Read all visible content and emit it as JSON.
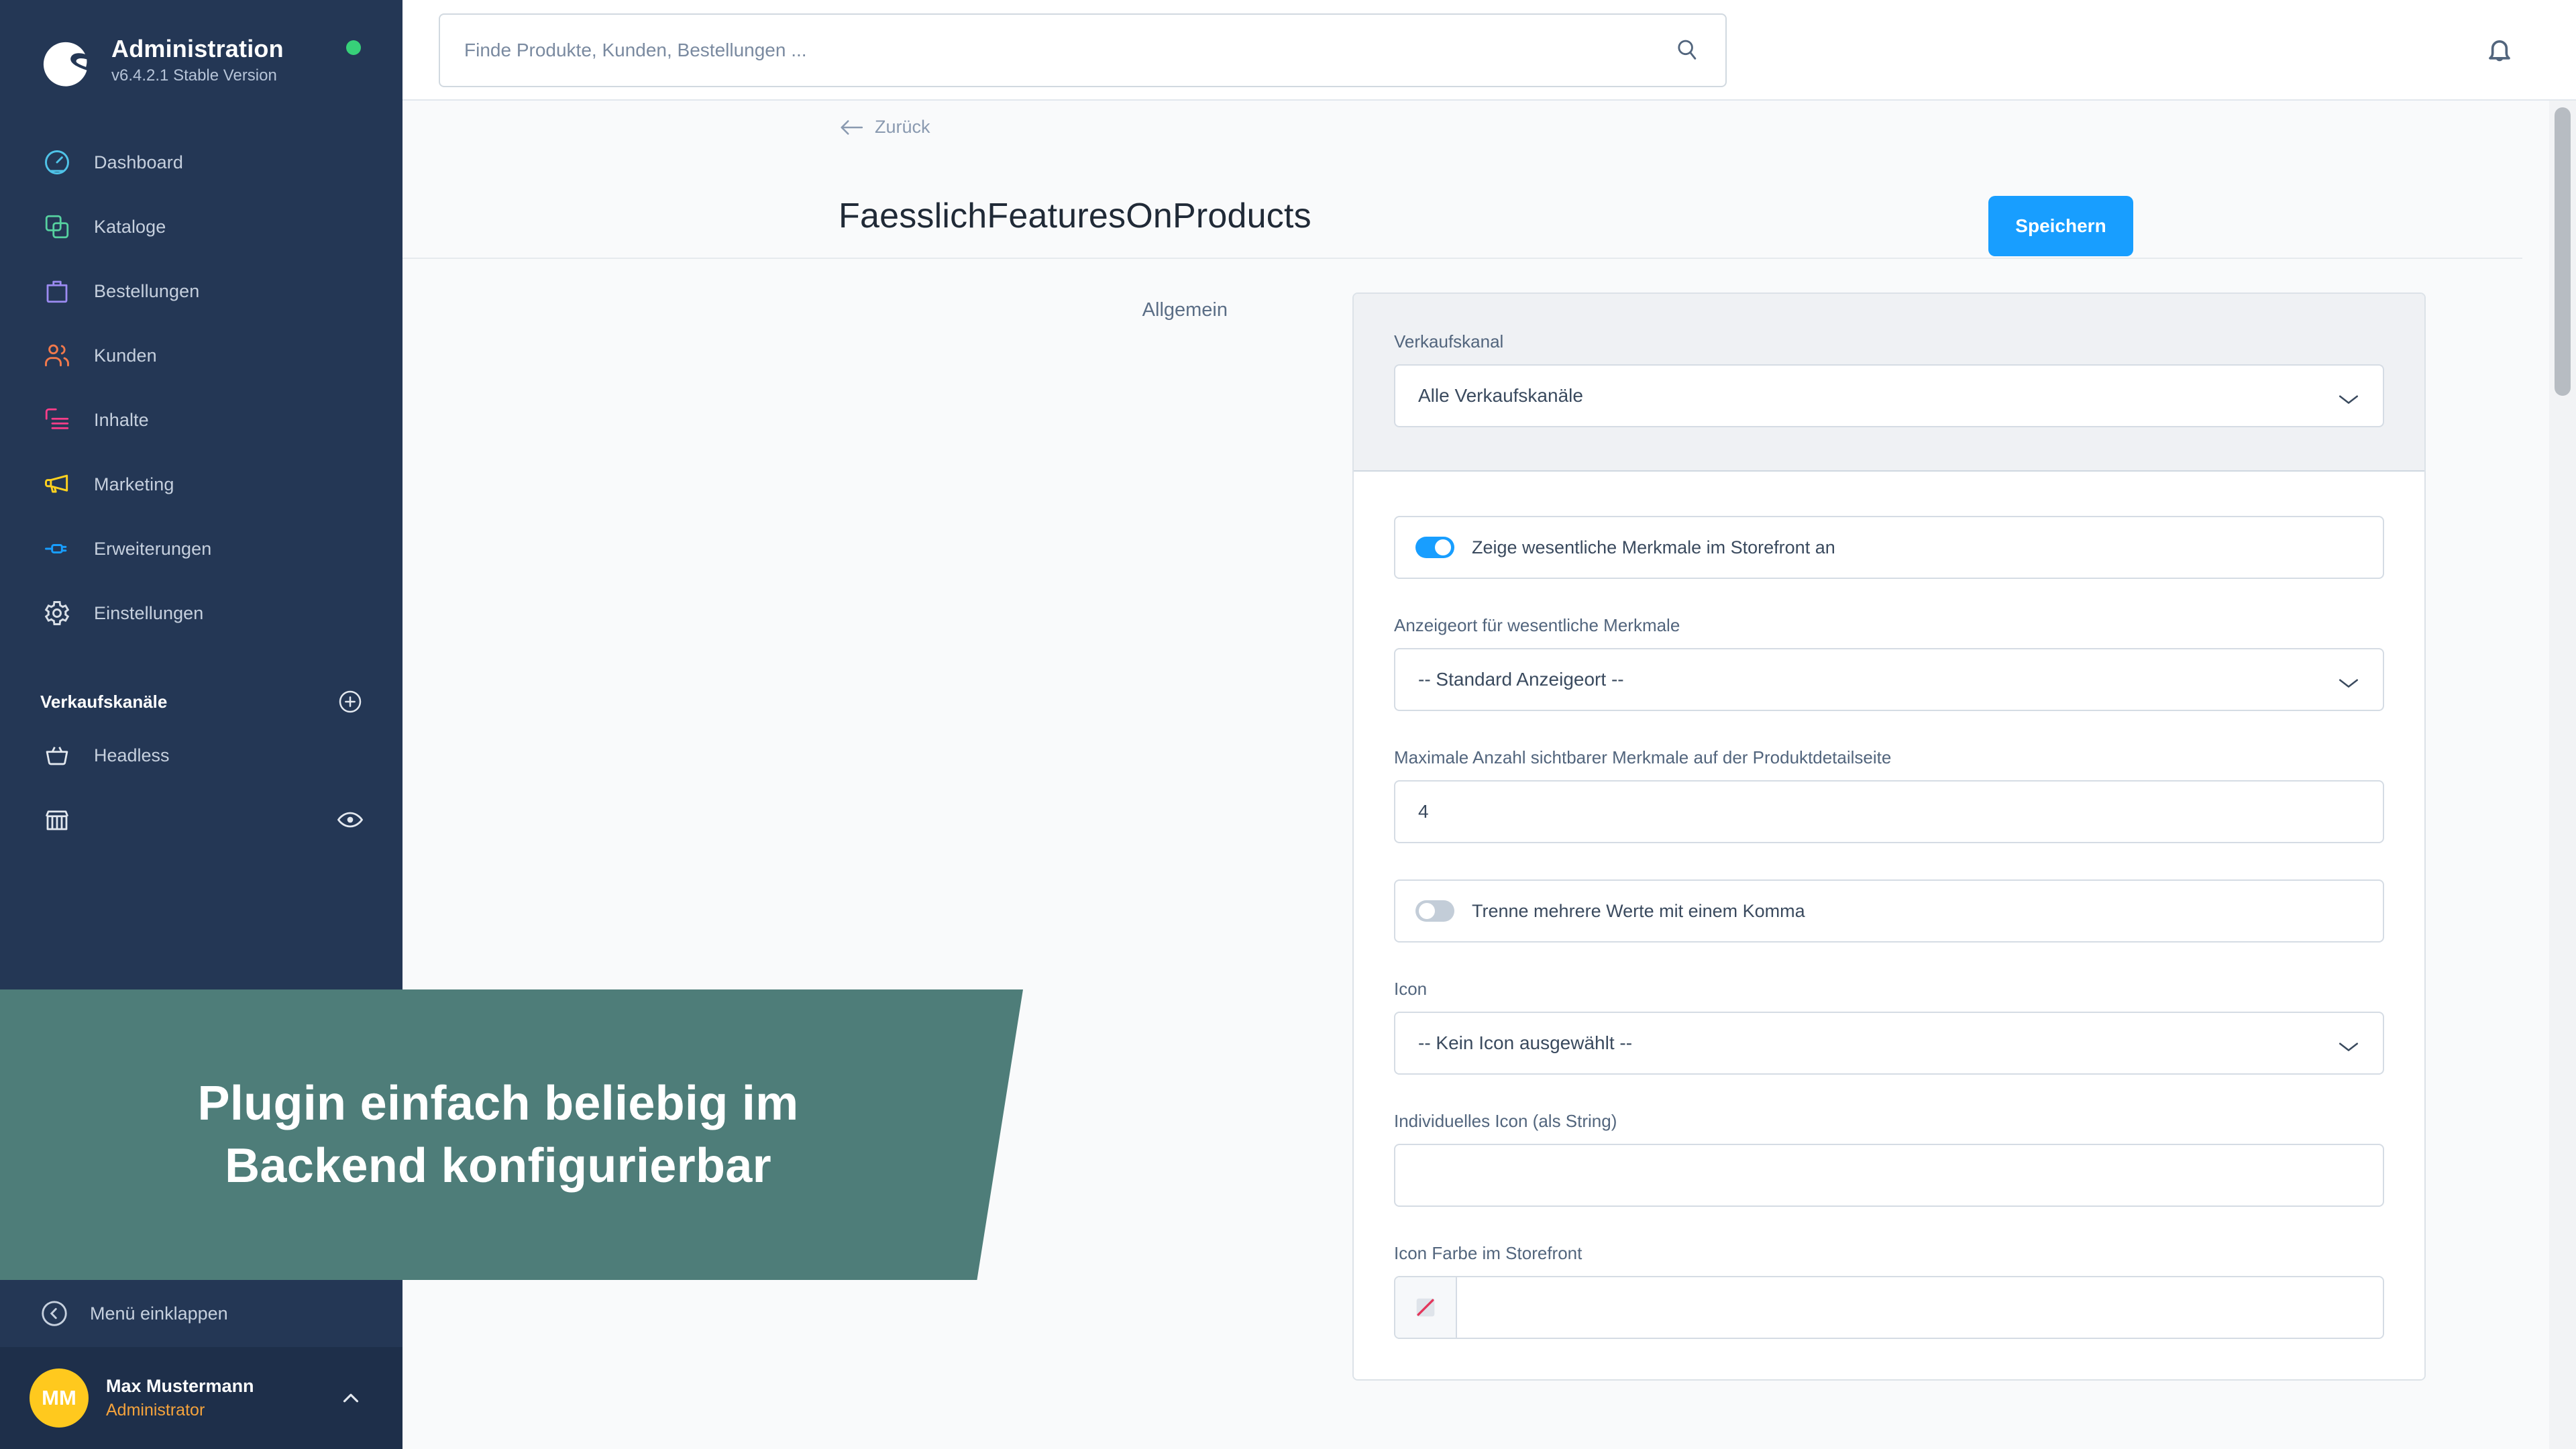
{
  "sidebar": {
    "title": "Administration",
    "version": "v6.4.2.1 Stable Version",
    "status_color": "#37D079",
    "items": [
      {
        "label": "Dashboard",
        "icon": "gauge-icon",
        "color": "#4FC3E8"
      },
      {
        "label": "Kataloge",
        "icon": "copy-icon",
        "color": "#56D1A0"
      },
      {
        "label": "Bestellungen",
        "icon": "bag-icon",
        "color": "#9C8BF2"
      },
      {
        "label": "Kunden",
        "icon": "users-icon",
        "color": "#F2794B"
      },
      {
        "label": "Inhalte",
        "icon": "content-icon",
        "color": "#FF3E8A"
      },
      {
        "label": "Marketing",
        "icon": "megaphone-icon",
        "color": "#FFD21E"
      },
      {
        "label": "Erweiterungen",
        "icon": "plug-icon",
        "color": "#189EFF"
      },
      {
        "label": "Einstellungen",
        "icon": "gear-icon",
        "color": "#D8DEE6"
      }
    ],
    "sales_channels_heading": "Verkaufskanäle",
    "channels": [
      {
        "label": "Headless",
        "icon": "basket-icon"
      },
      {
        "label": "",
        "icon": "storefront-icon"
      }
    ],
    "collapse_label": "Menü einklappen",
    "user": {
      "initials": "MM",
      "name": "Max Mustermann",
      "role": "Administrator",
      "avatar_color": "#FFC91E",
      "role_color": "#F5A33C"
    }
  },
  "topbar": {
    "search_placeholder": "Finde Produkte, Kunden, Bestellungen ...",
    "search_value": "",
    "search_icon": "search-icon",
    "notification_icon": "bell-icon"
  },
  "page": {
    "back_label": "Zurück",
    "title": "FaesslichFeaturesOnProducts",
    "save_label": "Speichern",
    "accent_color": "#189EFF",
    "section_label": "Allgemein"
  },
  "form": {
    "sales_channel": {
      "label": "Verkaufskanal",
      "value": "Alle Verkaufskanäle"
    },
    "show_features_toggle": {
      "label": "Zeige wesentliche Merkmale im Storefront an",
      "state": "on"
    },
    "display_location": {
      "label": "Anzeigeort für wesentliche Merkmale",
      "value": "-- Standard Anzeigeort --"
    },
    "max_features": {
      "label": "Maximale Anzahl sichtbarer Merkmale auf der Produktdetailseite",
      "value": "4"
    },
    "comma_toggle": {
      "label": "Trenne mehrere Werte mit einem Komma",
      "state": "off"
    },
    "icon_select": {
      "label": "Icon",
      "value": "-- Kein Icon ausgewählt --"
    },
    "custom_icon": {
      "label": "Individuelles Icon (als String)",
      "value": ""
    },
    "icon_color": {
      "label": "Icon Farbe im Storefront",
      "value": "",
      "swatch": "none-selected"
    }
  },
  "overlay": {
    "text": "Plugin einfach beliebig im Backend konfigurierbar",
    "background_color": "#4E7D79"
  }
}
